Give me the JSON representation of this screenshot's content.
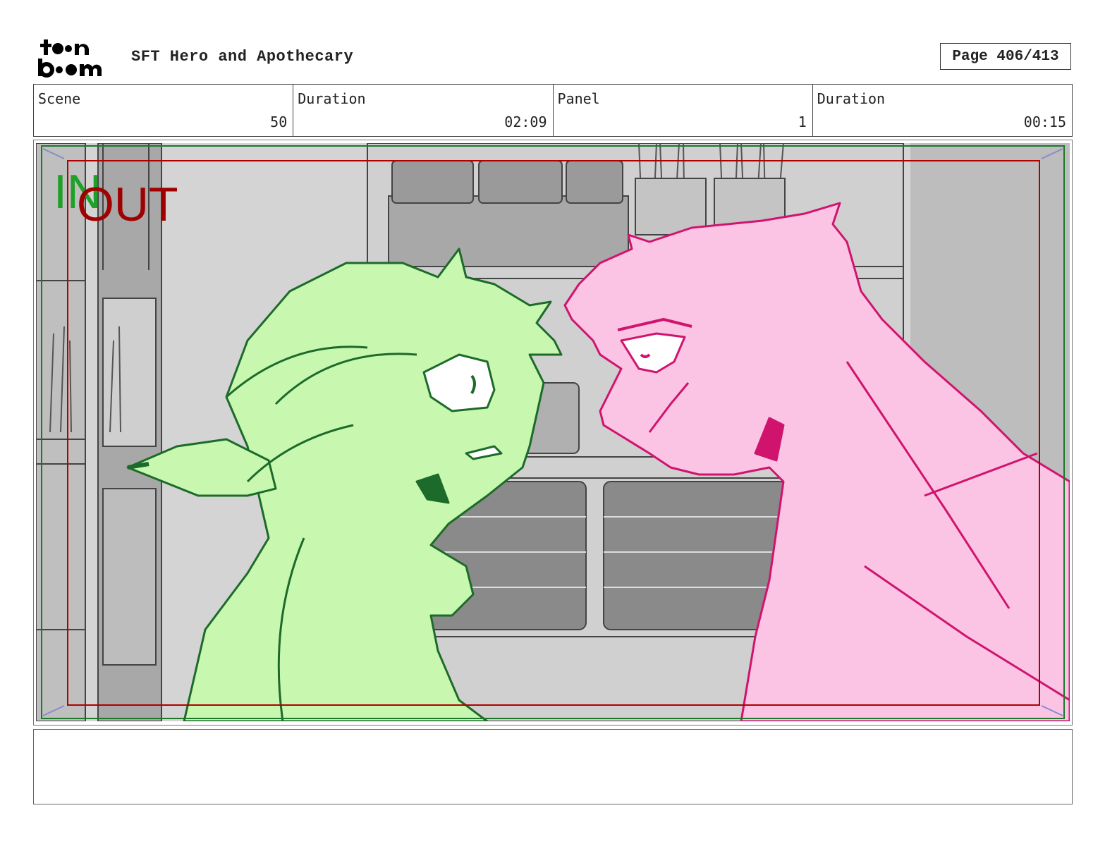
{
  "header": {
    "title": "SFT Hero and Apothecary",
    "page": "Page 406/413"
  },
  "info": {
    "scene_label": "Scene",
    "scene_value": "50",
    "duration_label": "Duration",
    "duration_value": "02:09",
    "panel_label": "Panel",
    "panel_value": "1",
    "panel_duration_label": "Duration",
    "panel_duration_value": "00:15"
  },
  "frame": {
    "in_label": "IN",
    "out_label": "OUT",
    "colors": {
      "in_green": "#1fa02a",
      "out_red": "#a00000",
      "green_character": "#c8f7b0",
      "green_line": "#1c6b2a",
      "pink_character": "#fbc4e4",
      "pink_line": "#d0146e",
      "background_gray": "#c9c9c9"
    }
  },
  "notes": {
    "text": ""
  }
}
